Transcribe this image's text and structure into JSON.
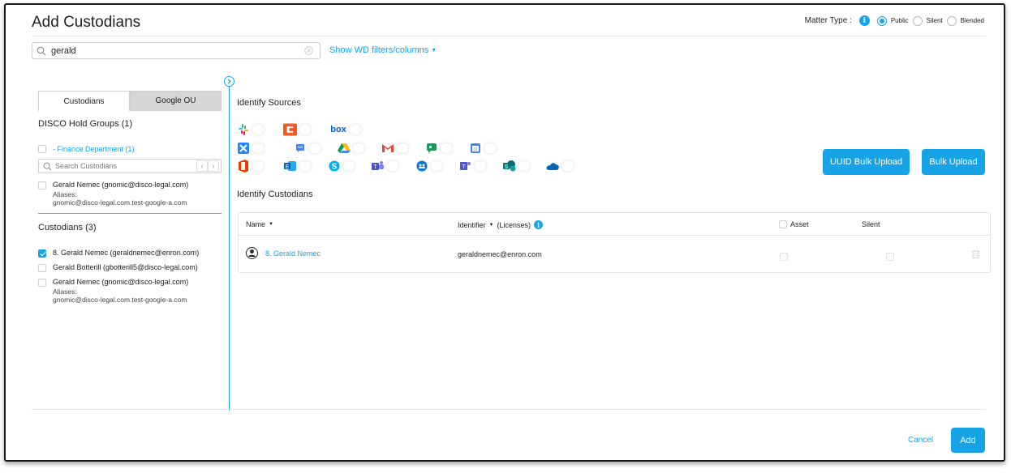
{
  "header": {
    "title": "Add Custodians",
    "matter_type_label": "Matter Type :",
    "matter_options": [
      "Public",
      "Silent",
      "Blended"
    ],
    "matter_selected": "Public"
  },
  "search": {
    "value": "gerald",
    "filters_link": "Show WD filters/columns"
  },
  "left": {
    "tabs": [
      "Custodians",
      "Google OU"
    ],
    "hold_groups_title": "DISCO Hold Groups (1)",
    "group_item": "- Finance Department (1)",
    "search_placeholder": "Search Custodians",
    "group_member": {
      "name": "Gerald Nemec (gnomic@disco-legal.com)",
      "aliases_label": "Aliases:",
      "aliases": "gnomic@disco-legal.com.test-google-a.com"
    },
    "custodians_title": "Custodians (3)",
    "custodians": [
      {
        "name": "8. Gerald Nemec (geraldnemec@enron.com)",
        "checked": true
      },
      {
        "name": "Gerald Botterill (gbotterill5@disco-legal.com)",
        "checked": false
      },
      {
        "name": "Gerald Nemec (gnomic@disco-legal.com)",
        "checked": false,
        "aliases_label": "Aliases:",
        "aliases": "gnomic@disco-legal.com.test-google-a.com"
      }
    ]
  },
  "sources": {
    "title": "Identify Sources",
    "icons_row1": [
      "slack-icon",
      "orange-c-icon",
      "box-icon"
    ],
    "box_text": "box",
    "icons_row2": [
      "jira-icon",
      "google-chat-icon",
      "google-drive-icon",
      "gmail-icon",
      "google-hangouts-icon",
      "google-calendar-icon"
    ],
    "icons_row3": [
      "office-icon",
      "exchange-icon",
      "skype-icon",
      "teams-icon",
      "groups-icon",
      "teams-chat-icon",
      "sharepoint-icon",
      "onedrive-icon"
    ]
  },
  "buttons": {
    "uuid_bulk": "UUID Bulk Upload",
    "bulk": "Bulk Upload",
    "cancel": "Cancel",
    "add": "Add"
  },
  "custodians_table": {
    "title": "Identify Custodians",
    "headers": {
      "name": "Name",
      "identifier": "Identifier",
      "licenses": "(Licenses)",
      "asset": "Asset",
      "silent": "Silent"
    },
    "rows": [
      {
        "name": "8. Gerald Nemec",
        "identifier": "geraldnemec@enron.com"
      }
    ]
  },
  "colors": {
    "accent": "#18a3e6"
  }
}
